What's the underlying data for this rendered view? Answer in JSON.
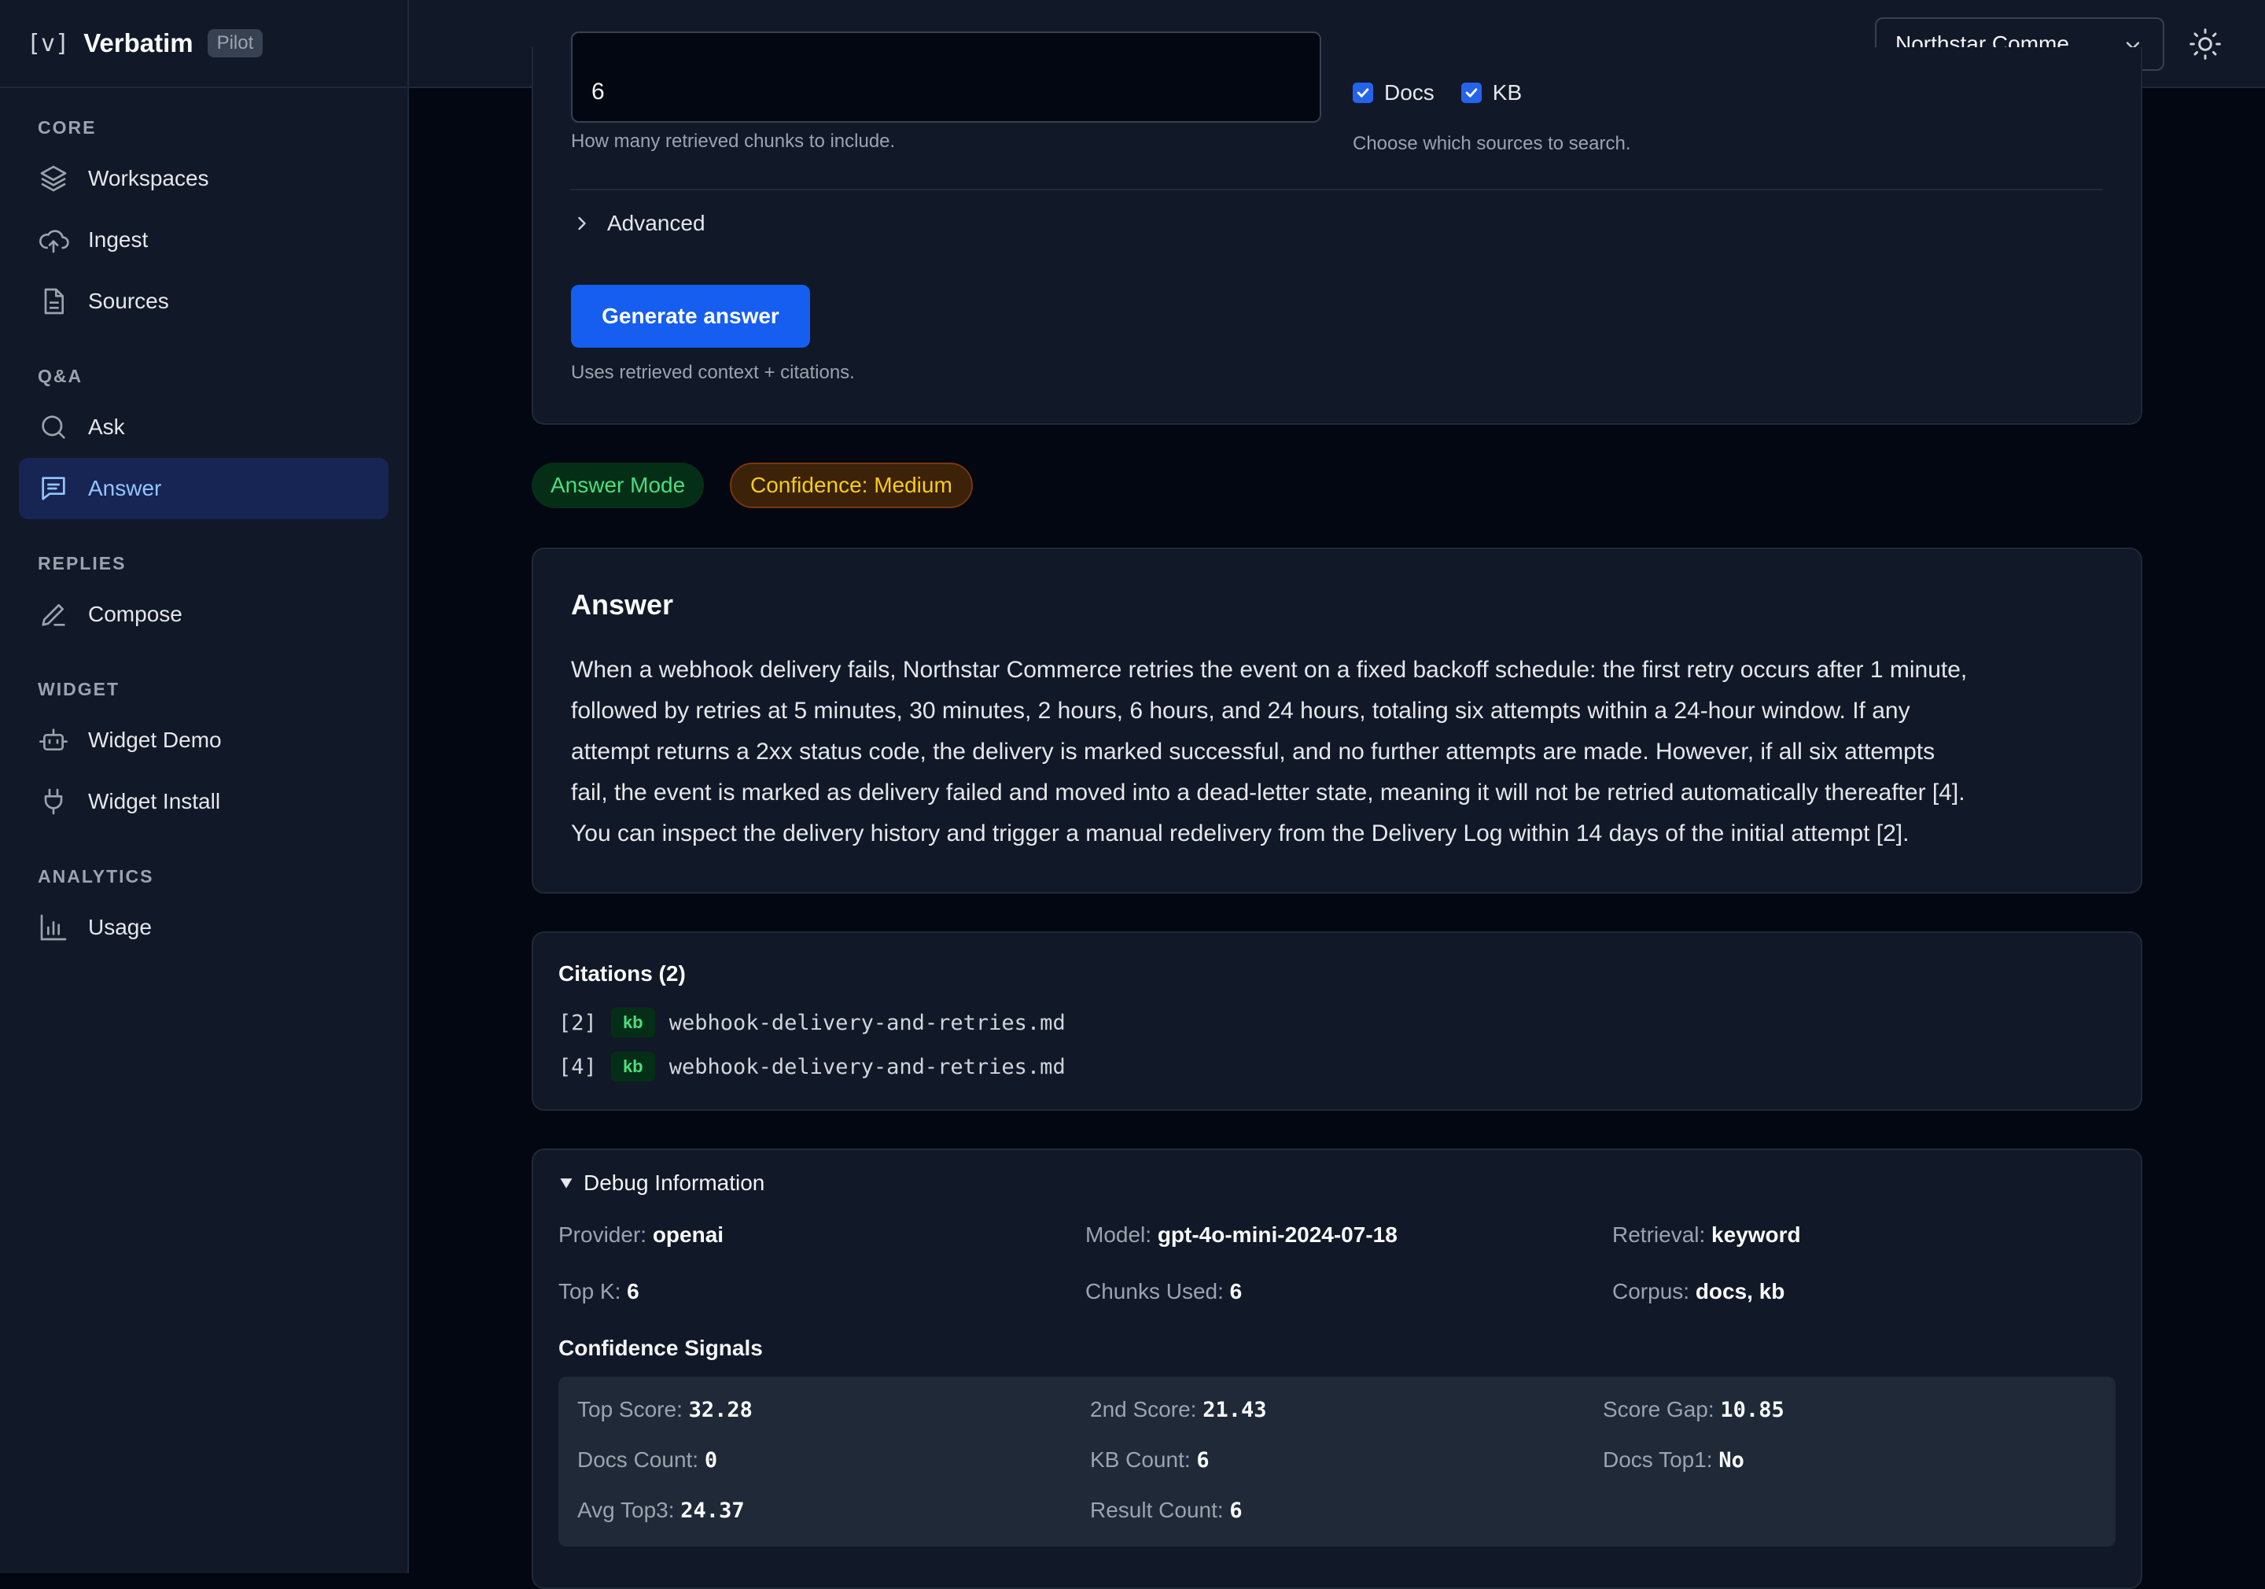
{
  "brand": {
    "mark": "[v]",
    "name": "Verbatim",
    "badge": "Pilot"
  },
  "sidebar": {
    "sections": [
      {
        "title": "CORE",
        "items": [
          {
            "label": "Workspaces",
            "icon": "layers-icon"
          },
          {
            "label": "Ingest",
            "icon": "cloud-upload-icon"
          },
          {
            "label": "Sources",
            "icon": "document-icon"
          }
        ]
      },
      {
        "title": "Q&A",
        "items": [
          {
            "label": "Ask",
            "icon": "search-icon"
          },
          {
            "label": "Answer",
            "icon": "message-icon",
            "active": true
          }
        ]
      },
      {
        "title": "REPLIES",
        "items": [
          {
            "label": "Compose",
            "icon": "pen-icon"
          }
        ]
      },
      {
        "title": "WIDGET",
        "items": [
          {
            "label": "Widget Demo",
            "icon": "bot-icon"
          },
          {
            "label": "Widget Install",
            "icon": "plug-icon"
          }
        ]
      },
      {
        "title": "ANALYTICS",
        "items": [
          {
            "label": "Usage",
            "icon": "bar-chart-icon"
          }
        ]
      }
    ]
  },
  "topbar": {
    "workspace": "Northstar Comme...",
    "theme_icon": "sun-icon"
  },
  "form": {
    "topk_value": "6",
    "topk_help": "How many retrieved chunks to include.",
    "sources": [
      {
        "label": "Docs",
        "checked": true
      },
      {
        "label": "KB",
        "checked": true
      }
    ],
    "sources_help": "Choose which sources to search.",
    "advanced_label": "Advanced",
    "generate_label": "Generate answer",
    "generate_help": "Uses retrieved context + citations."
  },
  "badges": {
    "mode": "Answer Mode",
    "confidence": "Confidence: Medium"
  },
  "answer": {
    "title": "Answer",
    "lines": [
      "When a webhook delivery fails, Northstar Commerce retries the event on a fixed backoff schedule: the first retry occurs after 1 minute,",
      "followed by retries at 5 minutes, 30 minutes, 2 hours, 6 hours, and 24 hours, totaling six attempts within a 24-hour window. If any",
      "attempt returns a 2xx status code, the delivery is marked successful, and no further attempts are made. However, if all six attempts",
      "fail, the event is marked as delivery failed and moved into a dead-letter state, meaning it will not be retried automatically thereafter [4].",
      "You can inspect the delivery history and trigger a manual redelivery from the Delivery Log within 14 days of the initial attempt [2]."
    ]
  },
  "citations": {
    "title": "Citations (2)",
    "items": [
      {
        "ref": "[2]",
        "tag": "kb",
        "file": "webhook-delivery-and-retries.md"
      },
      {
        "ref": "[4]",
        "tag": "kb",
        "file": "webhook-delivery-and-retries.md"
      }
    ]
  },
  "debug": {
    "title": "Debug Information",
    "rows": [
      [
        {
          "k": "Provider:",
          "v": "openai"
        },
        {
          "k": "Model:",
          "v": "gpt-4o-mini-2024-07-18"
        },
        {
          "k": "Retrieval:",
          "v": "keyword"
        }
      ],
      [
        {
          "k": "Top K:",
          "v": "6"
        },
        {
          "k": "Chunks Used:",
          "v": "6"
        },
        {
          "k": "Corpus:",
          "v": "docs, kb"
        }
      ]
    ],
    "signals_title": "Confidence Signals",
    "signals": [
      [
        {
          "k": "Top Score:",
          "v": "32.28"
        },
        {
          "k": "2nd Score:",
          "v": "21.43"
        },
        {
          "k": "Score Gap:",
          "v": "10.85"
        }
      ],
      [
        {
          "k": "Docs Count:",
          "v": "0"
        },
        {
          "k": "KB Count:",
          "v": "6"
        },
        {
          "k": "Docs Top1:",
          "v": "No"
        }
      ],
      [
        {
          "k": "Avg Top3:",
          "v": "24.37"
        },
        {
          "k": "Result Count:",
          "v": "6"
        }
      ]
    ]
  }
}
